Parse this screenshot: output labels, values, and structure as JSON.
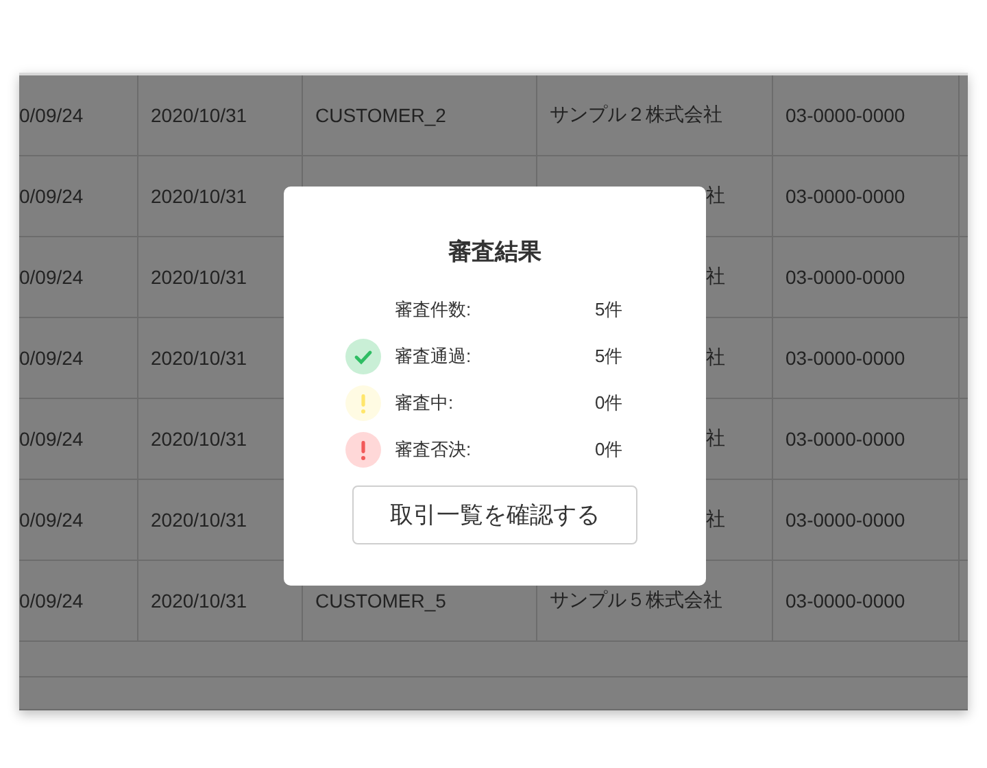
{
  "table": {
    "rows": [
      {
        "cells": [
          "0/09/24",
          "2020/10/31",
          "CUSTOMER_2",
          "サンプル２株式会社",
          "03-0000-0000"
        ]
      },
      {
        "cells": [
          "0/09/24",
          "2020/10/31",
          null,
          "社",
          "03-0000-0000"
        ]
      },
      {
        "cells": [
          "0/09/24",
          "2020/10/31",
          null,
          "社",
          "03-0000-0000"
        ]
      },
      {
        "cells": [
          "0/09/24",
          "2020/10/31",
          null,
          "社",
          "03-0000-0000"
        ]
      },
      {
        "cells": [
          "0/09/24",
          "2020/10/31",
          null,
          "社",
          "03-0000-0000"
        ]
      },
      {
        "cells": [
          "0/09/24",
          "2020/10/31",
          null,
          "社",
          "03-0000-0000"
        ]
      },
      {
        "cells": [
          "0/09/24",
          "2020/10/31",
          "CUSTOMER_5",
          "サンプル５株式会社",
          "03-0000-0000"
        ]
      }
    ]
  },
  "dialog": {
    "title": "審査結果",
    "stats": [
      {
        "kind": "total",
        "label": "審査件数:",
        "value": "5件"
      },
      {
        "kind": "passed",
        "label": "審査通過:",
        "value": "5件"
      },
      {
        "kind": "pending",
        "label": "審査中:",
        "value": "0件"
      },
      {
        "kind": "rejected",
        "label": "審査否決:",
        "value": "0件"
      }
    ],
    "button": "取引一覧を確認する"
  }
}
